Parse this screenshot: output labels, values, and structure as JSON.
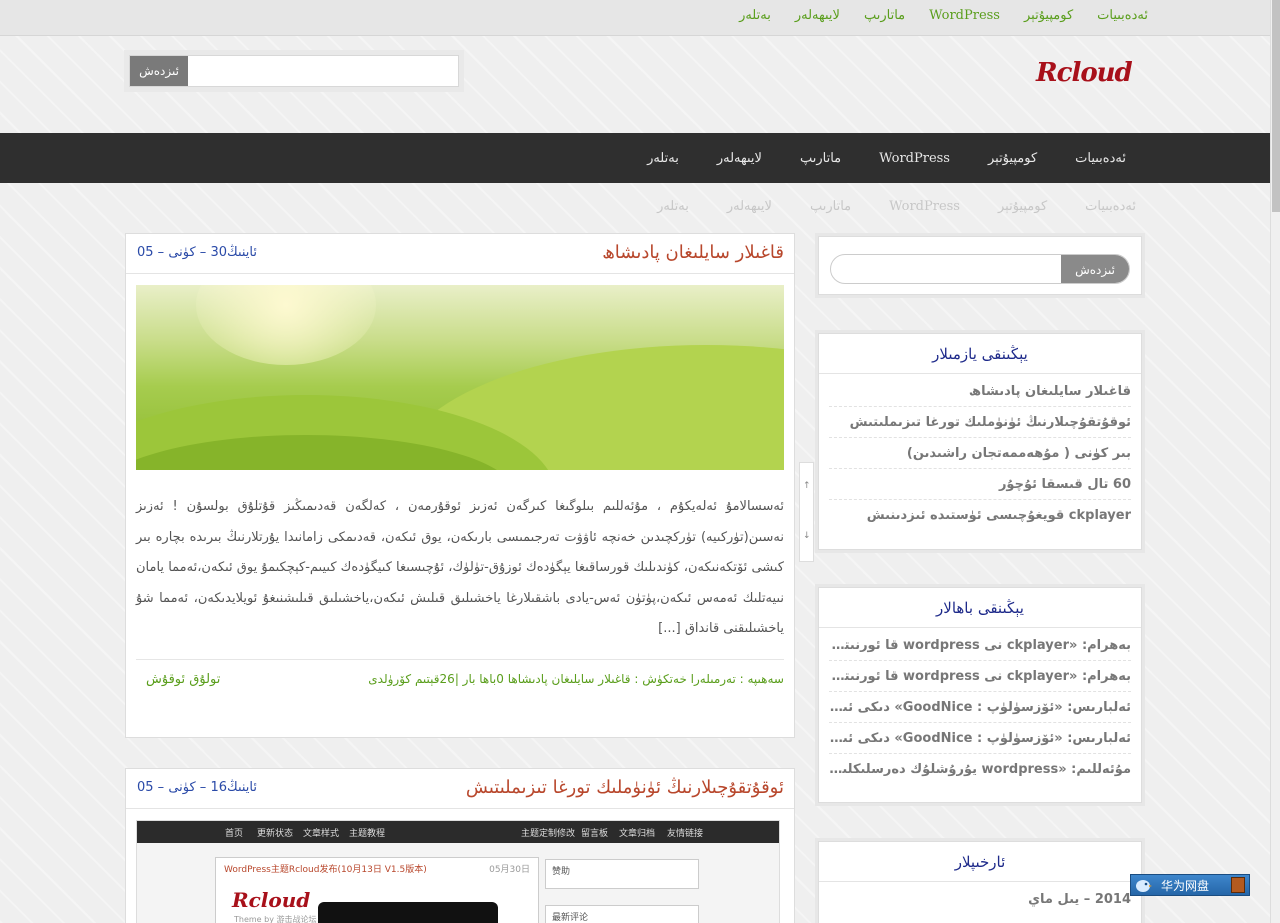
{
  "topnav": {
    "items": [
      "ئەدەبىيات",
      "كومپيۇتېر",
      "WordPress",
      "ماتارىپ",
      "لايىھەلەر",
      "بەتلەر"
    ]
  },
  "header": {
    "logo": "Rcloud",
    "search_button": "ئىزدەش",
    "search_value": ""
  },
  "mainnav": {
    "items": [
      "ئەدەبىيات",
      "كومپيۇتېر",
      "WordPress",
      "ماتارىپ",
      "لايىھەلەر",
      "بەتلەر"
    ]
  },
  "posts": [
    {
      "title": "قاغىلار سايلىغان پادىشاھ",
      "date": "05 – ئاينىڭ30 – كۈنى",
      "body": "ئەسسالامۇ ئەلەيكۇم ، مۇئەللىم بىلوگىغا كىرگەن ئەزىز ئوقۇرمەن ، كەلگەن قەدىمىڭىز قۇتلۇق بولسۇن ! ئەزىز نەسىن(تۈركىيە) تۈركچىدىن خەنچە ئاۋۋت تەرجىمىسى بارىكەن، يوق ئىكەن، قەدىمكى زامانىدا يۇرتلارنىڭ بىرىدە بچارە بىر كىشى ئۆتكەنىكەن، كۈندىلىك قورساقىغا يېگۈدەك ئوزۇق-تۈلۈك، ئۇچىسىغا كىيگۈدەك كىيىم-كېچكىمۇ يوق ئىكەن،ئەمما يامان نىيەتلىك ئەمەس ئىكەن،پۈتۈن ئەس-يادى باشقىلارغا ياخشىلىق قىلىش ئىكەن،ياخشىلىق قىلىشنىغۇ ئويلايدىكەن، ئەمما شۇ ياخشىلىقنى قانداق [...]",
      "meta_left": "تولۇق ئوقۇش",
      "meta_right": "سەھىپە : تەرمىلەرا  خەتكۈش : قاغىلار سايلىغان پادىشاھا  0باھا بار  |26قېتىم كۆرۈلدى"
    },
    {
      "title": "ئوقۇتقۇچىلارنىڭ ئۈنۈملىك تورغا تىزىملىتىش",
      "date": "05 – ئاينىڭ16 – كۈنى",
      "screenshot": {
        "nav": [
          "首页",
          "更新状态",
          "文章样式",
          "主题教程",
          "主题定制修改",
          "留言板",
          "文章归档",
          "友情链接"
        ],
        "headline": "WordPress主题Rcloud发布(10月13日 V1.5版本)",
        "date": "05月30日",
        "logo": "Rcloud",
        "logo_sub": "Theme by 游击战论坛",
        "side_1": "赞助",
        "side_2": "最新评论"
      }
    }
  ],
  "sidebar": {
    "search_button": "ئىزدەش",
    "search_value": "",
    "recent_posts": {
      "title": "يېڭىنقى يازمىلار",
      "items": [
        "قاغىلار سايلىغان پادىشاھ",
        "ئوقۇتقۇچىلارنىڭ ئۈنۈملىك تورغا تىزىملىتىش",
        "بىر كۈنى ( مۇھەممەتجان راشىدىن)",
        "60 تال قىسقا ئۇچۇر",
        "ckplayer قويغۇچىسى ئۈستىدە ئىزدىنىش"
      ]
    },
    "recent_comments": {
      "title": "يېڭىنقى باھالار",
      "items": [
        "بەھرام: «ckplayer نى wordpress قا ئورنىتىش» دىك...",
        "بەھرام: «ckplayer نى wordpress قا ئورنىتىش» دىك...",
        "ئەلبارىس: «ئۆزسۈلۈپ : GoodNice» دىكى ئىنكاس",
        "ئەلبارىس: «ئۆزسۈلۈپ : GoodNice» دىكى ئىنكاس",
        "مۇئەللىم: «wordpress يۇرۇشلۇك دەرسلىكلىرى» د..."
      ]
    },
    "archives": {
      "title": "ئارخىپلار",
      "items": [
        "2014 – يىل ماي"
      ]
    }
  },
  "scroll_arrows": {
    "up": "↑",
    "down": "↓"
  },
  "badge": {
    "label": "华为网盘"
  }
}
